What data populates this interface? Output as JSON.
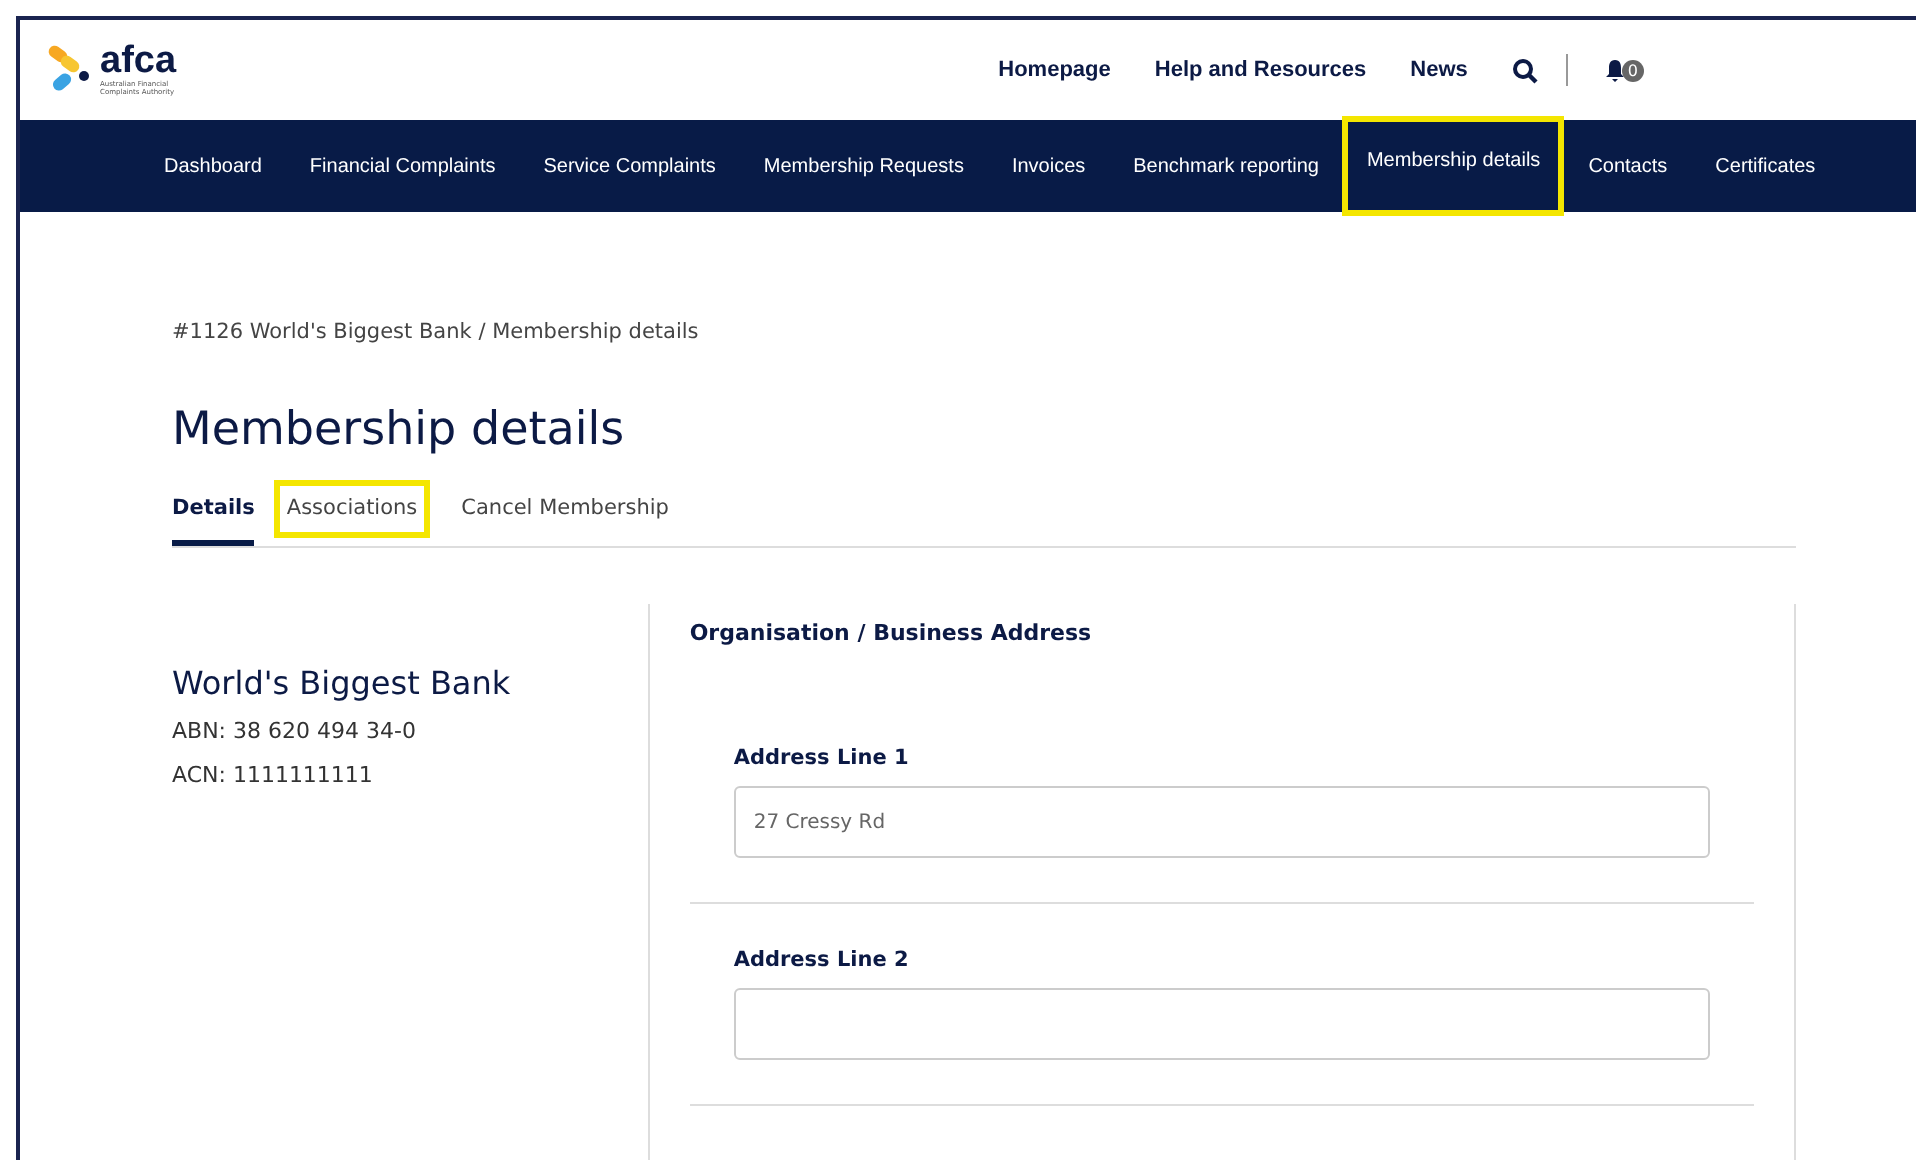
{
  "header": {
    "logo_text": "afca",
    "logo_subtitle": "Australian Financial Complaints Authority",
    "links": [
      {
        "label": "Homepage"
      },
      {
        "label": "Help and Resources"
      },
      {
        "label": "News"
      }
    ],
    "notification_count": "0"
  },
  "nav": [
    {
      "label": "Dashboard",
      "highlighted": false
    },
    {
      "label": "Financial Complaints",
      "highlighted": false
    },
    {
      "label": "Service Complaints",
      "highlighted": false
    },
    {
      "label": "Membership Requests",
      "highlighted": false
    },
    {
      "label": "Invoices",
      "highlighted": false
    },
    {
      "label": "Benchmark reporting",
      "highlighted": false
    },
    {
      "label": "Membership details",
      "highlighted": true
    },
    {
      "label": "Contacts",
      "highlighted": false
    },
    {
      "label": "Certificates",
      "highlighted": false
    }
  ],
  "breadcrumb": "#1126 World's Biggest Bank / Membership details",
  "page_title": "Membership details",
  "tabs": [
    {
      "label": "Details",
      "selected": true,
      "highlighted": false
    },
    {
      "label": "Associations",
      "selected": false,
      "highlighted": true
    },
    {
      "label": "Cancel Membership",
      "selected": false,
      "highlighted": false
    }
  ],
  "organisation": {
    "name": "World's Biggest Bank",
    "lines": [
      "ABN: 38 620 494 34-0",
      "ACN: 1111111111"
    ]
  },
  "address_panel": {
    "title": "Organisation / Business Address",
    "fields": [
      {
        "label": "Address Line 1",
        "value": "27 Cressy Rd"
      },
      {
        "label": "Address Line 2"
      }
    ]
  }
}
